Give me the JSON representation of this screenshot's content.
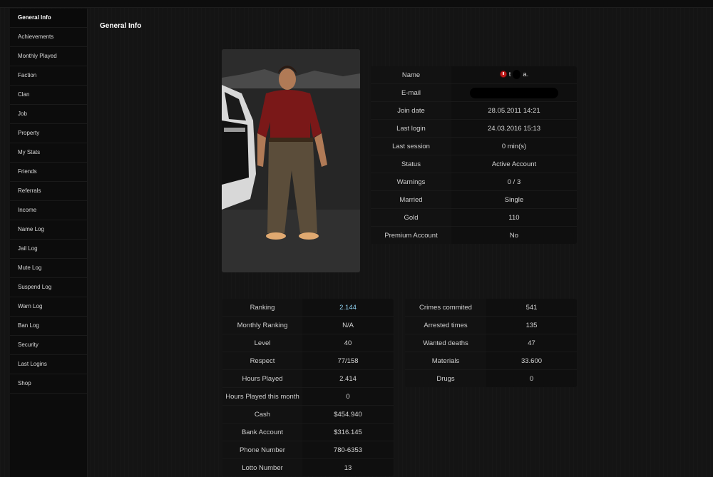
{
  "sidebar": {
    "items": [
      {
        "label": "General Info",
        "active": true
      },
      {
        "label": "Achievements"
      },
      {
        "label": "Monthly Played"
      },
      {
        "label": "Faction"
      },
      {
        "label": "Clan"
      },
      {
        "label": "Job"
      },
      {
        "label": "Property"
      },
      {
        "label": "My Stats"
      },
      {
        "label": "Friends"
      },
      {
        "label": "Referrals"
      },
      {
        "label": "Income"
      },
      {
        "label": "Name Log"
      },
      {
        "label": "Jail Log"
      },
      {
        "label": "Mute Log"
      },
      {
        "label": "Suspend Log"
      },
      {
        "label": "Warn Log"
      },
      {
        "label": "Ban Log"
      },
      {
        "label": "Security"
      },
      {
        "label": "Last Logins"
      },
      {
        "label": "Shop"
      }
    ]
  },
  "page": {
    "title": "General Info"
  },
  "profile": {
    "name_label": "Name",
    "name_first": "t",
    "name_last": "a.",
    "email_label": "E-mail",
    "rows": [
      {
        "label": "Join date",
        "value": "28.05.2011 14:21"
      },
      {
        "label": "Last login",
        "value": "24.03.2016 15:13"
      },
      {
        "label": "Last session",
        "value": "0 min(s)"
      },
      {
        "label": "Status",
        "value": "Active Account"
      },
      {
        "label": "Warnings",
        "value": "0 / 3"
      },
      {
        "label": "Married",
        "value": "Single"
      },
      {
        "label": "Gold",
        "value": "110"
      },
      {
        "label": "Premium Account",
        "value": "No"
      }
    ]
  },
  "stats": {
    "rows": [
      {
        "label": "Ranking",
        "value": "2.144"
      },
      {
        "label": "Monthly Ranking",
        "value": "N/A"
      },
      {
        "label": "Level",
        "value": "40"
      },
      {
        "label": "Respect",
        "value": "77/158"
      },
      {
        "label": "Hours Played",
        "value": "2.414"
      },
      {
        "label": "Hours Played this month",
        "value": "0"
      },
      {
        "label": "Cash",
        "value": "$454.940"
      },
      {
        "label": "Bank Account",
        "value": "$316.145"
      },
      {
        "label": "Phone Number",
        "value": "780-6353"
      },
      {
        "label": "Lotto Number",
        "value": "13"
      }
    ]
  },
  "crimes": {
    "rows": [
      {
        "label": "Crimes commited",
        "value": "541"
      },
      {
        "label": "Arrested times",
        "value": "135"
      },
      {
        "label": "Wanted deaths",
        "value": "47"
      },
      {
        "label": "Materials",
        "value": "33.600"
      },
      {
        "label": "Drugs",
        "value": "0"
      }
    ]
  },
  "colors": {
    "background": "#141414",
    "sidebar": "#0c0c0c",
    "highlight": "#8fd0ef",
    "status_dot": "#c21a1a"
  }
}
